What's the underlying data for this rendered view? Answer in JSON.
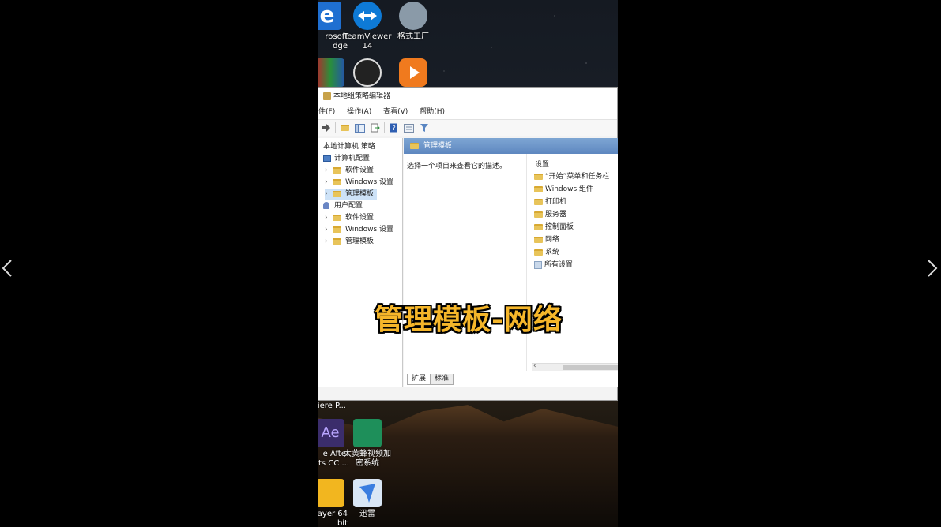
{
  "nav": {
    "prev_icon": "chevron-left-icon",
    "next_icon": "chevron-right-icon"
  },
  "desktop": {
    "top_icons": [
      {
        "label": "rosoft\ndge",
        "icon": "edge-icon",
        "color": "#1f6fd1"
      },
      {
        "label": "TeamViewer\n14",
        "icon": "teamviewer-icon",
        "color": "#0e7ad6"
      },
      {
        "label": "格式工厂",
        "icon": "format-factory-icon",
        "color": "#8a9aa8"
      }
    ],
    "second_row_icons": [
      {
        "icon": "winrar-icon",
        "color": "#b5282d"
      },
      {
        "icon": "obs-icon",
        "color": "#222222"
      },
      {
        "icon": "video-player-icon",
        "color": "#f07a1e"
      }
    ],
    "bottom_icons": [
      {
        "label": "iere P...",
        "icon": "premiere-icon"
      },
      {
        "label": "e After\nts CC ...",
        "icon": "after-effects-icon",
        "color": "#3b2d6b"
      },
      {
        "label": "大黄蜂视频加\n密系统",
        "icon": "video-encrypt-icon",
        "color": "#1e8f5a"
      },
      {
        "label": "layer 64\nbit",
        "icon": "potplayer-icon",
        "color": "#f2b61f"
      },
      {
        "label": "迅雷",
        "icon": "xunlei-icon",
        "color": "#3a7de0"
      }
    ]
  },
  "window": {
    "title": "本地组策略编辑器",
    "menu": [
      "件(F)",
      "操作(A)",
      "查看(V)",
      "帮助(H)"
    ],
    "tree": {
      "root": "本地计算机 策略",
      "computer_config": "计算机配置",
      "computer_children": [
        "软件设置",
        "Windows 设置",
        "管理模板"
      ],
      "user_config": "用户配置",
      "user_children": [
        "软件设置",
        "Windows 设置",
        "管理模板"
      ]
    },
    "right_header": "管理模板",
    "description": "选择一个项目来查看它的描述。",
    "list_header": "设置",
    "list_items": [
      "“开始”菜单和任务栏",
      "Windows 组件",
      "打印机",
      "服务器",
      "控制面板",
      "网络",
      "系统"
    ],
    "all_settings": "所有设置",
    "tabs": [
      "扩展",
      "标准"
    ]
  },
  "caption": "管理模板-网络"
}
